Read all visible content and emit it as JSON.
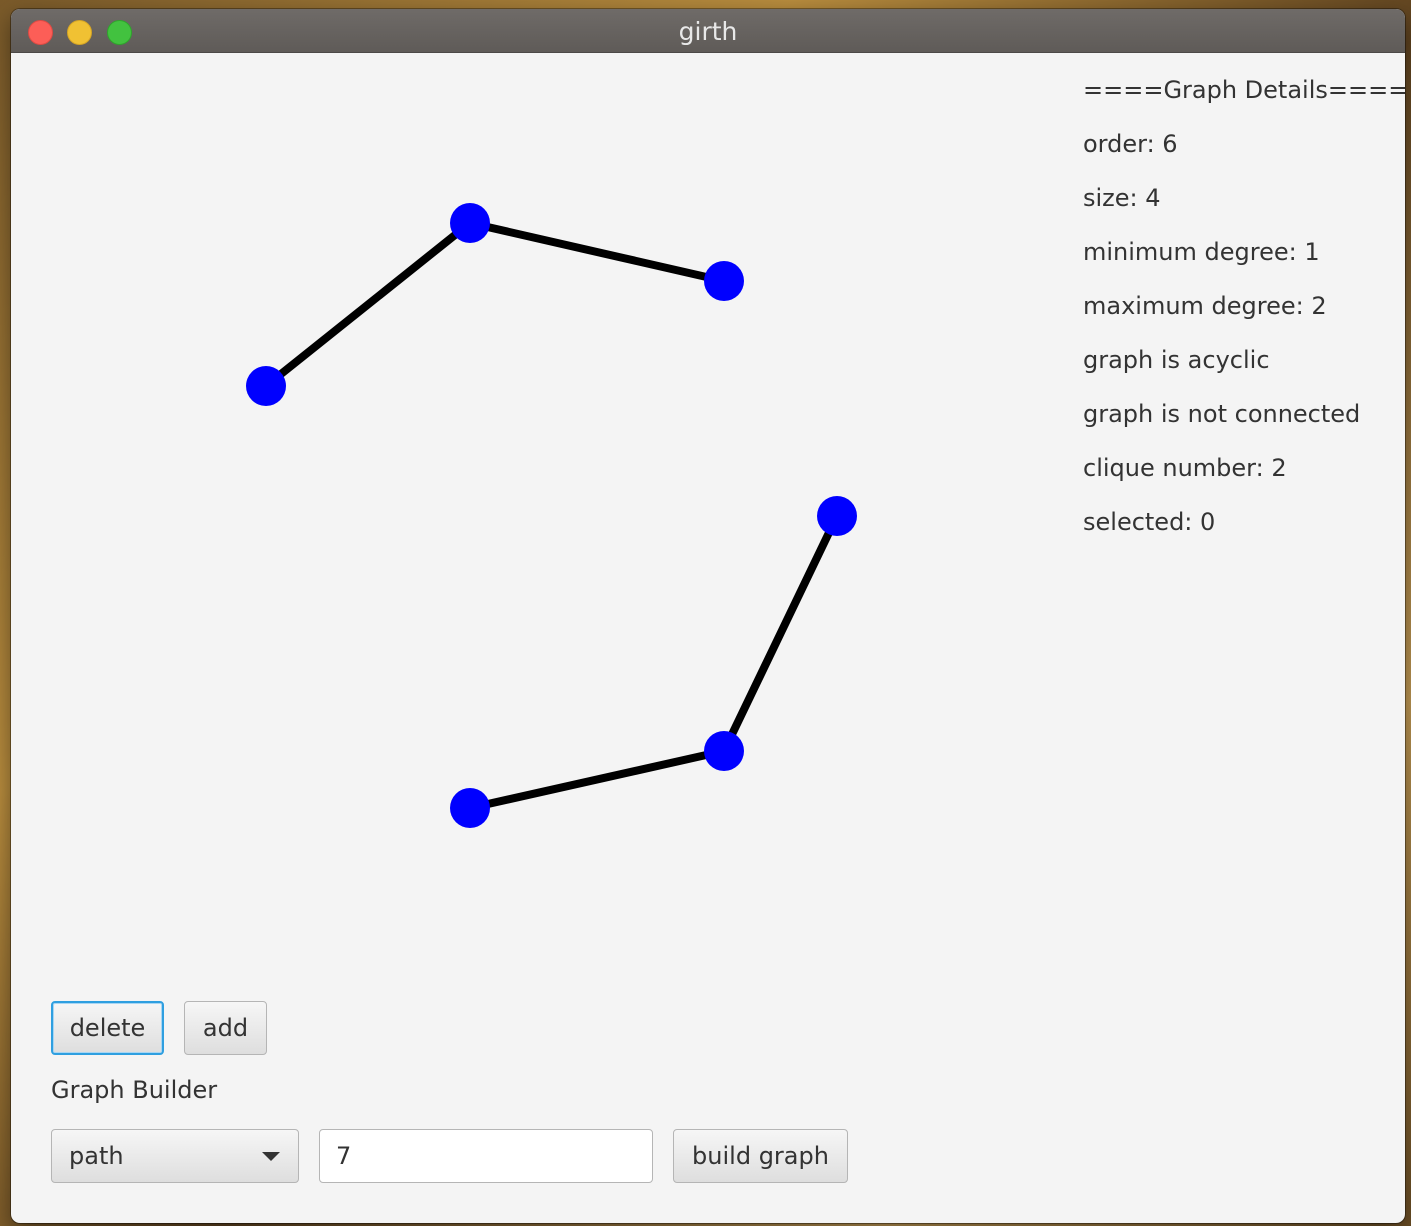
{
  "window": {
    "title": "girth"
  },
  "graph": {
    "vertex_color": "#0000ff",
    "edge_color": "#000000"
  },
  "details": {
    "header": "====Graph Details====",
    "order": "order: 6",
    "size": "size: 4",
    "min_degree": "minimum degree: 1",
    "max_degree": "maximum degree: 2",
    "acyclic": "graph is acyclic",
    "connected": "graph is not connected",
    "clique": "clique number: 2",
    "selected": "selected: 0"
  },
  "controls": {
    "delete_label": "delete",
    "add_label": "add",
    "builder_label": "Graph Builder",
    "graph_type": "path",
    "count_value": "7",
    "build_label": "build graph"
  }
}
